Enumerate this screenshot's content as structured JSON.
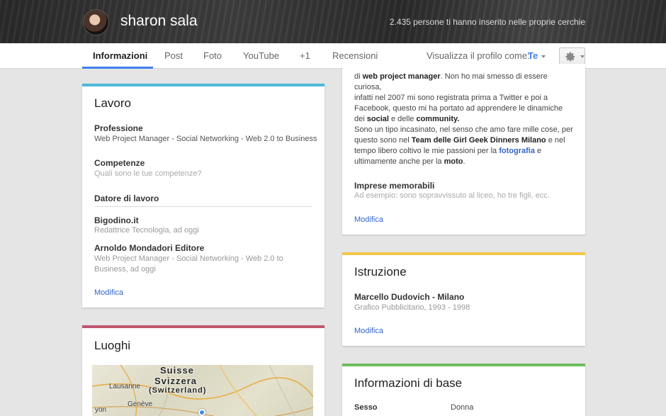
{
  "header": {
    "name": "sharon sala",
    "circles_text": "2.435 persone ti hanno inserito nelle proprie cerchie"
  },
  "tabs": [
    {
      "label": "Informazioni",
      "active": true
    },
    {
      "label": "Post"
    },
    {
      "label": "Foto"
    },
    {
      "label": "YouTube"
    },
    {
      "label": "+1"
    },
    {
      "label": "Recensioni"
    }
  ],
  "view_as": {
    "label": "Visualizza il profilo come:",
    "value": "Te"
  },
  "colors": {
    "accent": "#427fed",
    "work_bar": "#4fb9d8",
    "places_bar": "#c0566f",
    "education_bar": "#f4c749",
    "basic_bar": "#6ebd5f",
    "link": "#3366cc"
  },
  "work": {
    "title": "Lavoro",
    "profession_label": "Professione",
    "profession_value": "Web Project Manager - Social Networking - Web 2.0 to Business",
    "skills_label": "Competenze",
    "skills_hint": "Quali sono le tue competenze?",
    "employer_label": "Datore di lavoro",
    "employers": [
      {
        "name": "Bigodino.it",
        "detail": "Redattrice Tecnologia, ad oggi"
      },
      {
        "name": "Arnoldo Mondadori Editore",
        "detail": "Web Project Manager - Social Networking - Web 2.0 to Business, ad oggi"
      }
    ],
    "edit_label": "Modifica"
  },
  "places": {
    "title": "Luoghi",
    "map_labels": {
      "country1": "Suisse",
      "country2": "Svizzera",
      "country3": "(Switzerland)",
      "city1": "Lausanne",
      "city2": "Genève",
      "city3": "yon"
    }
  },
  "about": {
    "line0_pre": "di ",
    "line0_bold": "web project manager",
    "line0_post": ". Non ho mai smesso di essere curiosa,",
    "line1": "infatti nel 2007 mi sono registrata prima a Twitter e poi a",
    "line2": "Facebook, questo mi ha portato ad apprendere le dinamiche",
    "line3_pre": "dei ",
    "line3_b1": "social",
    "line3_mid": " e delle ",
    "line3_b2": "community.",
    "para2_line1": "Sono un tipo incasinato, nel senso che amo fare mille cose, per",
    "para2_line2_pre": "questo sono nel ",
    "para2_line2_bold": "Team delle Girl Geek Dinners Milano",
    "para2_line2_post": " e nel",
    "para2_line3_pre": "tempo libero coltivo le mie passioni per la ",
    "para2_line3_link": "fotografia",
    "para2_line3_post": " e",
    "para2_line4_pre": "ultimamente anche per la ",
    "para2_line4_bold": "moto",
    "para2_line4_post": ".",
    "achievements_label": "Imprese memorabili",
    "achievements_hint": "Ad esempio: sono sopravvissuto al liceo, ho tre figli, ecc.",
    "edit_label": "Modifica"
  },
  "education": {
    "title": "Istruzione",
    "school": "Marcello Dudovich - Milano",
    "detail": "Grafico Pubblicitario, 1993 - 1998",
    "edit_label": "Modifica"
  },
  "basic": {
    "title": "Informazioni di base",
    "rows": [
      {
        "label": "Sesso",
        "value": "Donna"
      }
    ]
  }
}
